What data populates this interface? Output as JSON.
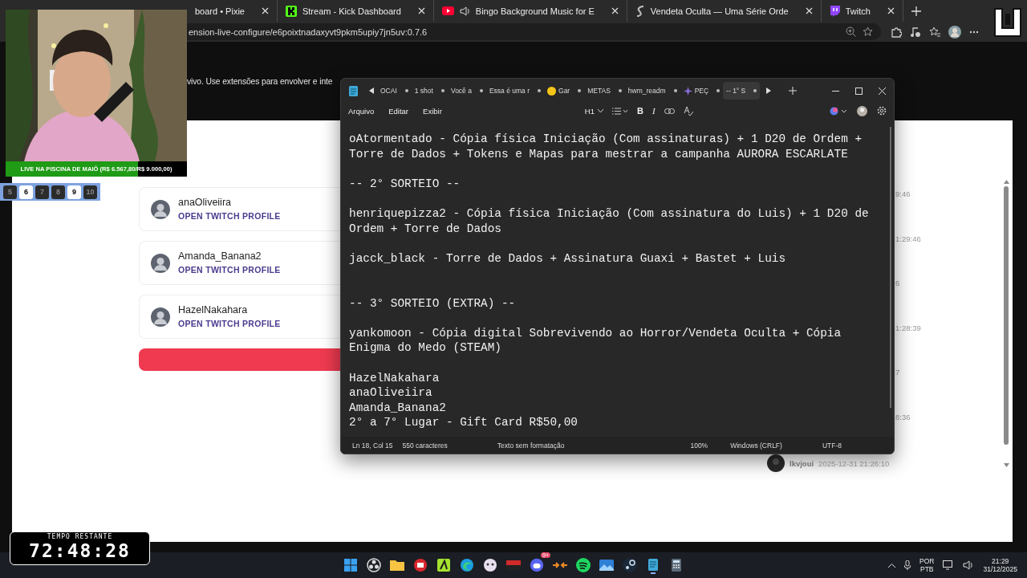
{
  "browser": {
    "tabs": [
      {
        "title": "board • Pixie"
      },
      {
        "title": "Stream - Kick Dashboard"
      },
      {
        "title": "Bingo Background Music for E"
      },
      {
        "title": "Vendeta Oculta — Uma Série Orde"
      },
      {
        "title": "Twitch"
      }
    ],
    "address": "ension-live-configure/e6poixtnadaxyvt9pkm5upiy7jn5uv:0.7.6",
    "page": {
      "intro": "vivo. Use extensões para envolver e inte",
      "winners": [
        {
          "name": "anaOliveiira",
          "link": "OPEN TWITCH PROFILE"
        },
        {
          "name": "Amanda_Banana2",
          "link": "OPEN TWITCH PROFILE"
        },
        {
          "name": "HazelNakahara",
          "link": "OPEN TWITCH PROFILE"
        }
      ],
      "timestamps": [
        "9:46",
        "1:29:46",
        "6",
        "1:28:39",
        "7",
        "8:36"
      ],
      "comment": {
        "user": "lkvjoui",
        "time": "2025-12-31 21:26:10"
      }
    }
  },
  "notepad": {
    "tabs": [
      {
        "label": "OCAI",
        "selected": false
      },
      {
        "label": "1 shot",
        "selected": false
      },
      {
        "label": "Você a",
        "selected": false
      },
      {
        "label": "Essa é uma r",
        "selected": false
      },
      {
        "label": "Gar",
        "selected": false
      },
      {
        "label": "METAS",
        "selected": false
      },
      {
        "label": "hwm_readm",
        "selected": false
      },
      {
        "label": "PEÇ",
        "selected": false
      },
      {
        "label": "-- 1° S",
        "selected": true
      }
    ],
    "menu": [
      "Arquivo",
      "Editar",
      "Exibir"
    ],
    "heading": "H1",
    "bold": "B",
    "italic": "I",
    "paragraphs": [
      {
        "kind": "text",
        "lines": [
          "oAtormentado - Cópia física Iniciação (Com assinaturas) + 1 D20 de Ordem +",
          "Torre de Dados + Tokens e Mapas para mestrar a campanha AURORA ESCARLATE"
        ]
      },
      {
        "kind": "text",
        "lines": [
          "-- 2° SORTEIO --"
        ]
      },
      {
        "kind": "text",
        "lines": [
          "henriquepizza2 - Cópia física Iniciação (Com assinatura do Luis) + 1 D20 de",
          "Ordem + Torre de Dados"
        ]
      },
      {
        "kind": "text",
        "lines": [
          "jacck_black - Torre de Dados + Assinatura Guaxi + Bastet + Luis"
        ]
      },
      {
        "kind": "gap"
      },
      {
        "kind": "text",
        "lines": [
          "-- 3° SORTEIO (EXTRA) --"
        ]
      },
      {
        "kind": "text",
        "lines": [
          "yankomoon - Cópia digital Sobrevivendo ao Horror/Vendeta Oculta + Cópia",
          "Enigma do Medo (STEAM)"
        ]
      },
      {
        "kind": "text",
        "lines": [
          "HazelNakahara",
          "anaOliveiira",
          "Amanda_Banana2",
          "2° a 7° Lugar - Gift Card R$50,00"
        ]
      }
    ],
    "status": [
      "Ln 18, Col 15",
      "550 caracteres",
      "Texto sem formatação",
      "100%",
      "Windows (CRLF)",
      "UTF-8"
    ]
  },
  "overlay": {
    "goal": {
      "text": "LIVE NA PISCINA DE MAIÔ (R$ 6.567,80/R$ 9.000,00)",
      "level": 0.73
    },
    "counter": [
      {
        "label": "5",
        "selected": false
      },
      {
        "label": "6",
        "selected": true
      },
      {
        "label": "7",
        "selected": false
      },
      {
        "label": "8",
        "selected": false
      },
      {
        "label": "9",
        "selected": true
      },
      {
        "label": "10",
        "selected": false
      }
    ],
    "timer": {
      "label": "TEMPO RESTANTE",
      "value": "72:48:28"
    }
  },
  "taskbar": {
    "badge": "9+",
    "language": "POR",
    "layout": "PTB",
    "time": "21:29",
    "date": "31/12/2025"
  }
}
